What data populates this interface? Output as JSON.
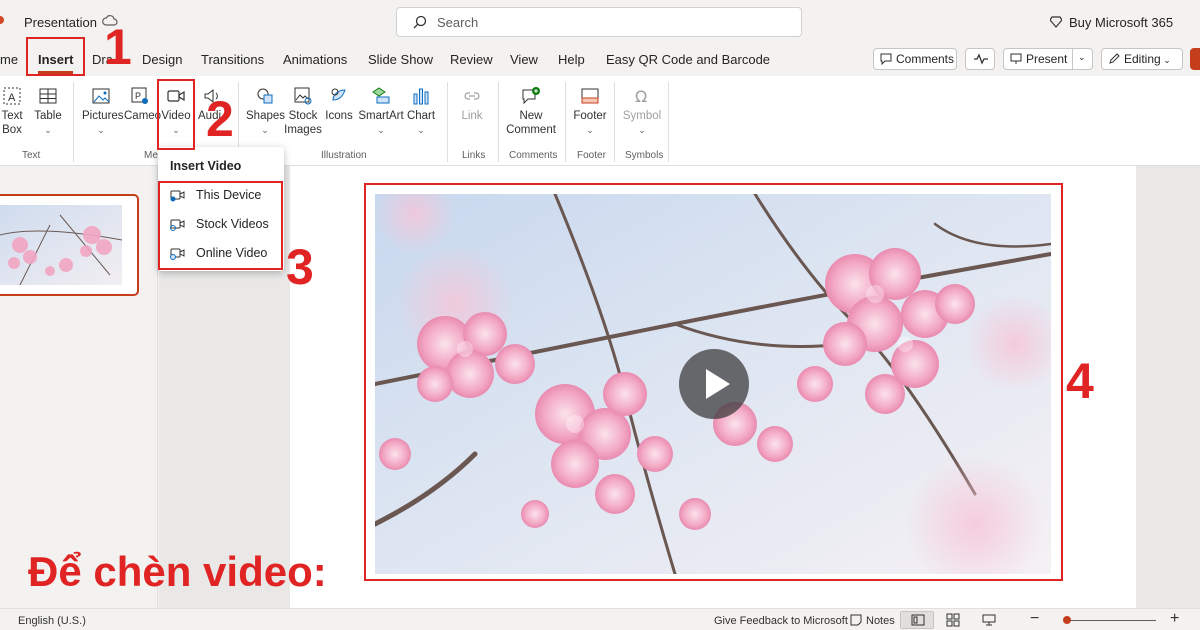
{
  "titlebar": {
    "doc_title": "Presentation",
    "search_placeholder": "Search",
    "buy_label": "Buy Microsoft 365"
  },
  "tabs": [
    {
      "label": "me"
    },
    {
      "label": "Insert"
    },
    {
      "label": "Dra"
    },
    {
      "label": "Design"
    },
    {
      "label": "Transitions"
    },
    {
      "label": "Animations"
    },
    {
      "label": "Slide Show"
    },
    {
      "label": "Review"
    },
    {
      "label": "View"
    },
    {
      "label": "Help"
    },
    {
      "label": "Easy QR Code and Barcode"
    }
  ],
  "right_buttons": {
    "comments": "Comments",
    "present": "Present",
    "editing": "Editing"
  },
  "ribbon": {
    "text_box": [
      "Text",
      "Box"
    ],
    "table": "Table",
    "pictures": "Pictures",
    "cameo": "Cameo",
    "video": "Video",
    "audio": "Audi",
    "shapes": "Shapes",
    "stock_images": [
      "Stock",
      "Images"
    ],
    "icons": "Icons",
    "smartart": "SmartArt",
    "chart": "Chart",
    "link": "Link",
    "new_comment": [
      "New",
      "Comment"
    ],
    "footer": "Footer",
    "symbol": "Symbol",
    "groups": {
      "text": "Text",
      "media": "Me",
      "illustration": "Illustration",
      "links": "Links",
      "comments": "Comments",
      "footer": "Footer",
      "symbols": "Symbols"
    }
  },
  "dropdown": {
    "title": "Insert Video",
    "items": [
      {
        "label": "This Device"
      },
      {
        "label": "Stock Videos"
      },
      {
        "label": "Online Video"
      }
    ]
  },
  "annotations": {
    "step1": "1",
    "step2": "2",
    "step3": "3",
    "step4": "4",
    "caption": "Để chèn video:"
  },
  "statusbar": {
    "language": "English (U.S.)",
    "feedback": "Give Feedback to Microsoft",
    "notes": "Notes"
  },
  "colors": {
    "accent": "#c43e1c",
    "annotation_red": "#e02424"
  }
}
